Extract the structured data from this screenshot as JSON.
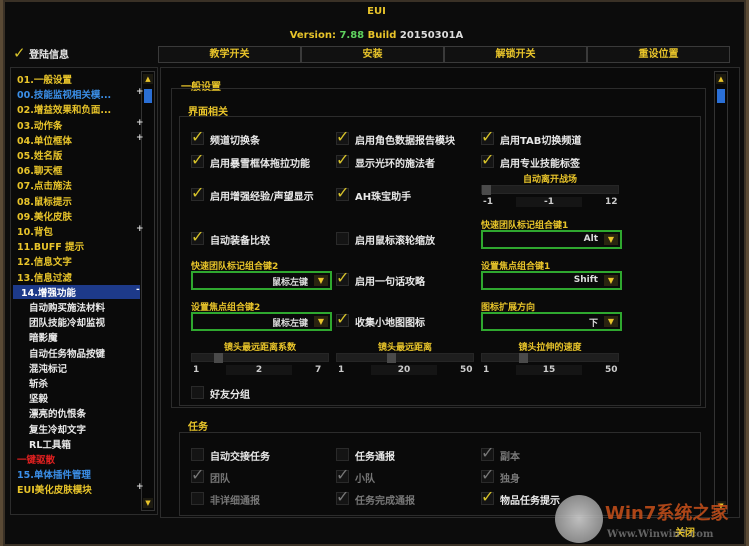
{
  "window": {
    "title": "EUI",
    "version_label": "Version:",
    "version": "7.88",
    "build_label": "Build",
    "build": "20150301A"
  },
  "header": {
    "login_info": "登陆信息",
    "tabs": [
      "教学开关",
      "安装",
      "解锁开关",
      "重设位置"
    ]
  },
  "sidebar": {
    "items": [
      {
        "label": "01.一般设置",
        "color": "yellow",
        "expand": ""
      },
      {
        "label": "00.技能监视相关模...",
        "color": "blue",
        "expand": "+"
      },
      {
        "label": "02.增益效果和负面...",
        "color": "yellow",
        "expand": ""
      },
      {
        "label": "03.动作条",
        "color": "yellow",
        "expand": "+"
      },
      {
        "label": "04.单位框体",
        "color": "yellow",
        "expand": "+"
      },
      {
        "label": "05.姓名版",
        "color": "yellow",
        "expand": ""
      },
      {
        "label": "06.聊天框",
        "color": "yellow",
        "expand": ""
      },
      {
        "label": "07.点击施法",
        "color": "yellow",
        "expand": ""
      },
      {
        "label": "08.鼠标提示",
        "color": "yellow",
        "expand": ""
      },
      {
        "label": "09.美化皮肤",
        "color": "yellow",
        "expand": ""
      },
      {
        "label": "10.背包",
        "color": "yellow",
        "expand": "+"
      },
      {
        "label": "11.BUFF 提示",
        "color": "yellow",
        "expand": ""
      },
      {
        "label": "12.信息文字",
        "color": "yellow",
        "expand": ""
      },
      {
        "label": "13.信息过滤",
        "color": "yellow",
        "expand": ""
      },
      {
        "label": "14.增强功能",
        "color": "selected",
        "expand": "-"
      },
      {
        "label": "自动购买施法材料",
        "color": "white",
        "expand": "",
        "indent": true
      },
      {
        "label": "团队技能冷却监视",
        "color": "white",
        "expand": "",
        "indent": true
      },
      {
        "label": "暗影魔",
        "color": "white",
        "expand": "",
        "indent": true
      },
      {
        "label": "自动任务物品按键",
        "color": "white",
        "expand": "",
        "indent": true
      },
      {
        "label": "混沌标记",
        "color": "white",
        "expand": "",
        "indent": true
      },
      {
        "label": "斩杀",
        "color": "white",
        "expand": "",
        "indent": true
      },
      {
        "label": "坚毅",
        "color": "white",
        "expand": "",
        "indent": true
      },
      {
        "label": "漂亮的仇恨条",
        "color": "white",
        "expand": "",
        "indent": true
      },
      {
        "label": "复生冷却文字",
        "color": "white",
        "expand": "",
        "indent": true
      },
      {
        "label": "RL工具箱",
        "color": "white",
        "expand": "",
        "indent": true
      },
      {
        "label": "一键驱散",
        "color": "red",
        "expand": ""
      },
      {
        "label": "15.单体插件管理",
        "color": "blue",
        "expand": ""
      },
      {
        "label": "EUI美化皮肤模块",
        "color": "yellow",
        "expand": "+"
      }
    ]
  },
  "main": {
    "section_title": "一般设置",
    "interface": {
      "title": "界面相关",
      "checkboxes": [
        {
          "label": "频道切换条",
          "checked": true
        },
        {
          "label": "启用角色数据报告模块",
          "checked": true
        },
        {
          "label": "启用TAB切换频道",
          "checked": true
        },
        {
          "label": "启用暴雪框体拖拉功能",
          "checked": true
        },
        {
          "label": "显示光环的施法者",
          "checked": true
        },
        {
          "label": "启用专业技能标签",
          "checked": true
        },
        {
          "label": "启用增强经验/声望显示",
          "checked": true
        },
        {
          "label": "AH珠宝助手",
          "checked": true
        },
        {
          "label": "自动装备比较",
          "checked": true
        },
        {
          "label": "启用鼠标滚轮缩放",
          "checked": false
        },
        {
          "label": "启用一句话攻略",
          "checked": true
        },
        {
          "label": "收集小地图图标",
          "checked": true
        },
        {
          "label": "好友分组",
          "checked": false
        }
      ],
      "dropdowns": [
        {
          "label": "快速团队标记组合键1",
          "value": "Alt"
        },
        {
          "label": "快速团队标记组合键2",
          "value": "鼠标左键"
        },
        {
          "label": "设置焦点组合键1",
          "value": "Shift"
        },
        {
          "label": "设置焦点组合键2",
          "value": "鼠标左键"
        },
        {
          "label": "图标扩展方向",
          "value": "下"
        }
      ],
      "sliders": [
        {
          "label": "自动离开战场",
          "min": "-1",
          "value": "-1",
          "max": "12",
          "fraction": 0.0
        },
        {
          "label": "镜头最远距离系数",
          "min": "1",
          "value": "2",
          "max": "7",
          "fraction": 0.17
        },
        {
          "label": "镜头最远距离",
          "min": "1",
          "value": "20",
          "max": "50",
          "fraction": 0.39
        },
        {
          "label": "镜头拉伸的速度",
          "min": "1",
          "value": "15",
          "max": "50",
          "fraction": 0.29
        }
      ]
    },
    "quests": {
      "title": "任务",
      "checkboxes": [
        {
          "label": "自动交接任务",
          "checked": false,
          "disabled": false
        },
        {
          "label": "任务通报",
          "checked": false,
          "disabled": false
        },
        {
          "label": "副本",
          "checked": true,
          "disabled": true
        },
        {
          "label": "团队",
          "checked": true,
          "disabled": true
        },
        {
          "label": "小队",
          "checked": true,
          "disabled": true
        },
        {
          "label": "独身",
          "checked": true,
          "disabled": true
        },
        {
          "label": "非详细通报",
          "checked": false,
          "disabled": true
        },
        {
          "label": "任务完成通报",
          "checked": true,
          "disabled": true
        },
        {
          "label": "物品任务提示",
          "checked": true,
          "disabled": false
        }
      ]
    }
  },
  "footer": {
    "close": "关闭"
  },
  "watermark": {
    "brand": "Win7系统之家",
    "url": "Www.Winwin7.com"
  }
}
